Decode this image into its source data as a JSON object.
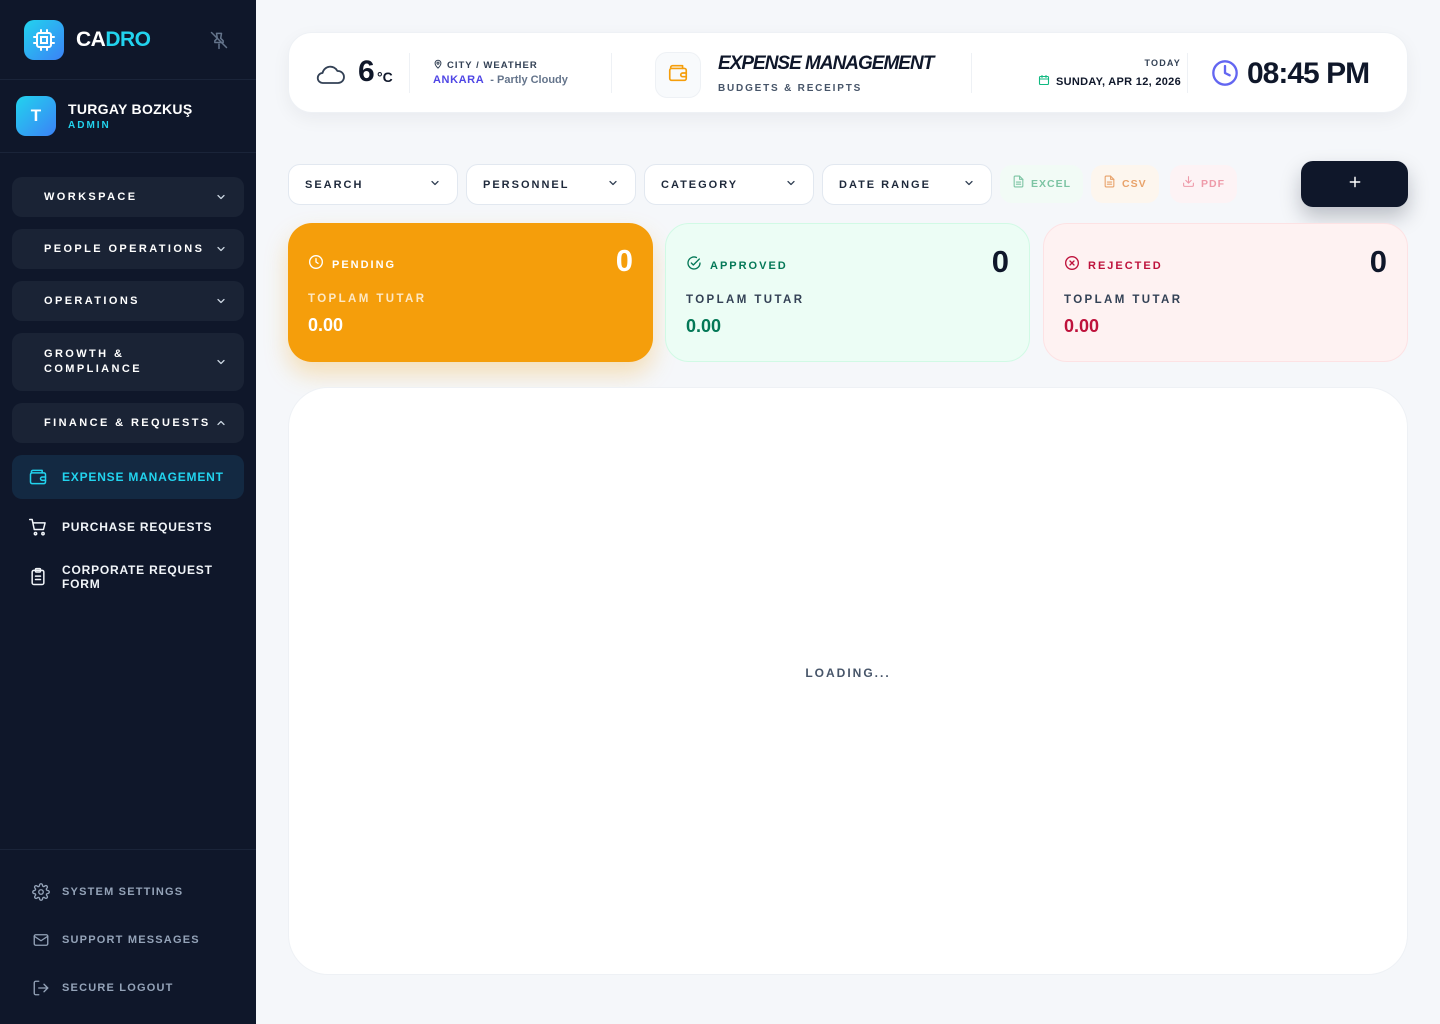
{
  "brand": {
    "part1": "CA",
    "part2": "DRO",
    "accent_color": "#22d3ee"
  },
  "user": {
    "initial": "T",
    "name": "TURGAY BOZKUŞ",
    "role": "ADMIN"
  },
  "sidebar": {
    "groups": [
      {
        "label": "WORKSPACE",
        "expanded": false
      },
      {
        "label": "PEOPLE OPERATIONS",
        "expanded": false
      },
      {
        "label": "OPERATIONS",
        "expanded": false
      },
      {
        "label": "GROWTH & COMPLIANCE",
        "expanded": false
      },
      {
        "label": "FINANCE & REQUESTS",
        "expanded": true
      }
    ],
    "subitems": [
      {
        "label": "EXPENSE MANAGEMENT",
        "icon": "wallet-icon",
        "active": true
      },
      {
        "label": "PURCHASE REQUESTS",
        "icon": "cart-icon",
        "active": false
      },
      {
        "label": "CORPORATE REQUEST FORM",
        "icon": "clipboard-icon",
        "active": false
      }
    ],
    "bottom": [
      {
        "label": "SYSTEM SETTINGS",
        "icon": "gear-icon"
      },
      {
        "label": "SUPPORT MESSAGES",
        "icon": "mail-icon"
      },
      {
        "label": "SECURE LOGOUT",
        "icon": "logout-icon"
      }
    ]
  },
  "header": {
    "temperature": "6",
    "temp_unit": "°C",
    "city_label": "CITY / WEATHER",
    "city": "ANKARA",
    "condition": "- Partly Cloudy",
    "page_title": "EXPENSE MANAGEMENT",
    "page_subtitle": "BUDGETS & RECEIPTS",
    "today_label": "TODAY",
    "date": "SUNDAY, APR 12, 2026",
    "time": "08:45 PM"
  },
  "filters": [
    "SEARCH",
    "PERSONNEL",
    "CATEGORY",
    "DATE RANGE"
  ],
  "exports": [
    {
      "label": "EXCEL",
      "color": "#7cc4a3"
    },
    {
      "label": "CSV",
      "color": "#e8a26a"
    },
    {
      "label": "PDF",
      "color": "#ee9aa9"
    }
  ],
  "stats": [
    {
      "status": "PENDING",
      "count": "0",
      "sub": "TOPLAM TUTAR",
      "amount": "0.00",
      "bg": "#f59e0b",
      "color": "#ffffff"
    },
    {
      "status": "APPROVED",
      "count": "0",
      "sub": "TOPLAM TUTAR",
      "amount": "0.00",
      "bg": "#ecfdf5",
      "color": "#047857"
    },
    {
      "status": "REJECTED",
      "count": "0",
      "sub": "TOPLAM TUTAR",
      "amount": "0.00",
      "bg": "#fef2f2",
      "color": "#be123c"
    }
  ],
  "content": {
    "loading_text": "LOADING..."
  }
}
